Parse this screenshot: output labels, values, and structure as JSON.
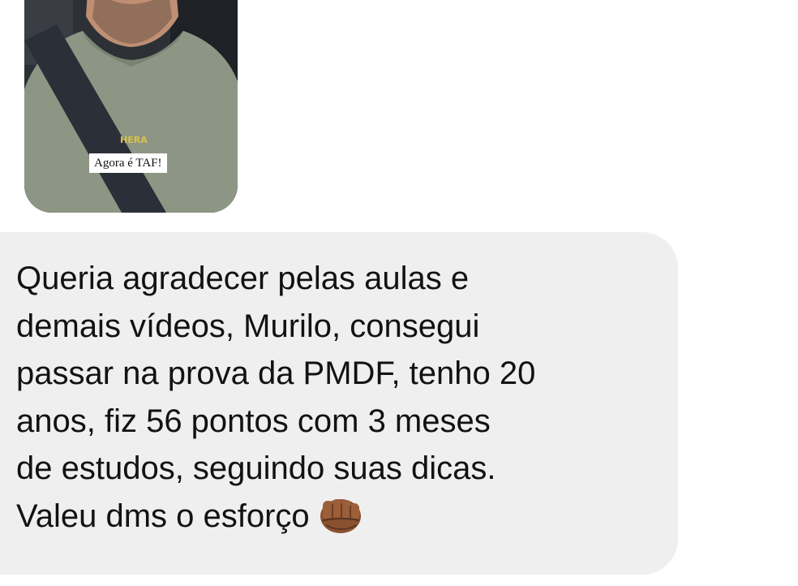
{
  "story": {
    "caption": "Agora é TAF!",
    "shirt_logo_text": "HERA"
  },
  "message": {
    "lines": [
      "Queria agradecer pelas aulas e",
      "demais vídeos, Murilo, consegui",
      "passar na prova da PMDF, tenho 20",
      "anos, fiz 56 pontos com 3 meses",
      "de estudos, seguindo suas dicas.",
      "Valeu dms o esforço"
    ],
    "emoji": "oncoming-fist-medium-dark-skin-tone"
  },
  "colors": {
    "bubble_background": "#efefef",
    "text": "#121212",
    "page_background": "#ffffff"
  }
}
